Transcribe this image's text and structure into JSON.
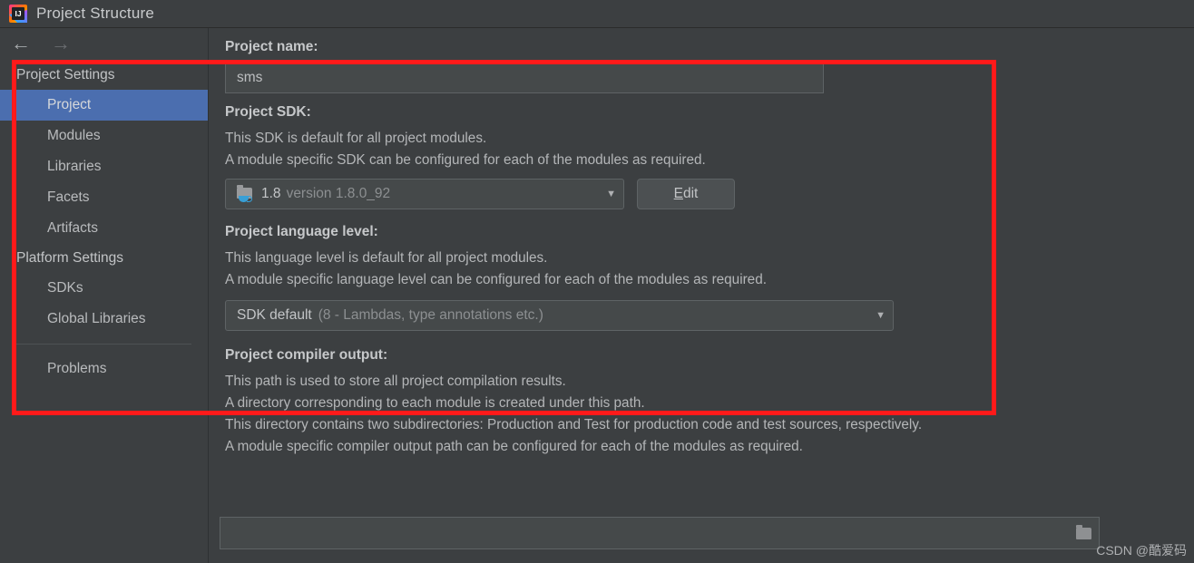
{
  "window": {
    "title": "Project Structure",
    "logo_icon": "intellij-idea-logo"
  },
  "nav": {
    "back_icon": "←",
    "forward_icon": "→"
  },
  "sidebar": {
    "groups": [
      {
        "label": "Project Settings",
        "items": [
          {
            "label": "Project",
            "selected": true
          },
          {
            "label": "Modules",
            "selected": false
          },
          {
            "label": "Libraries",
            "selected": false
          },
          {
            "label": "Facets",
            "selected": false
          },
          {
            "label": "Artifacts",
            "selected": false
          }
        ]
      },
      {
        "label": "Platform Settings",
        "items": [
          {
            "label": "SDKs",
            "selected": false
          },
          {
            "label": "Global Libraries",
            "selected": false
          }
        ]
      }
    ],
    "problems_label": "Problems"
  },
  "content": {
    "project_name": {
      "label": "Project name:",
      "value": "sms"
    },
    "project_sdk": {
      "label": "Project SDK:",
      "desc_1": "This SDK is default for all project modules.",
      "desc_2": "A module specific SDK can be configured for each of the modules as required.",
      "selected_name": "1.8",
      "selected_version": "version 1.8.0_92",
      "dropdown_arrow": "▼",
      "icon": "java-sdk-folder-icon",
      "edit_button": {
        "mnemonic": "E",
        "rest": "dit"
      }
    },
    "language_level": {
      "label": "Project language level:",
      "desc_1": "This language level is default for all project modules.",
      "desc_2": "A module specific language level can be configured for each of the modules as required.",
      "selected_main": "SDK default",
      "selected_detail": "(8 - Lambdas, type annotations etc.)",
      "dropdown_arrow": "▼"
    },
    "compiler_output": {
      "label": "Project compiler output:",
      "desc_1": "This path is used to store all project compilation results.",
      "desc_2": "A directory corresponding to each module is created under this path.",
      "desc_3": "This directory contains two subdirectories: Production and Test for production code and test sources, respectively.",
      "desc_4": "A module specific compiler output path can be configured for each of the modules as required.",
      "path_value": "",
      "browse_icon": "folder-browse-icon"
    }
  },
  "annotation": {
    "color": "#FF1A1A"
  },
  "watermark": {
    "text": "CSDN @酷爱码"
  }
}
